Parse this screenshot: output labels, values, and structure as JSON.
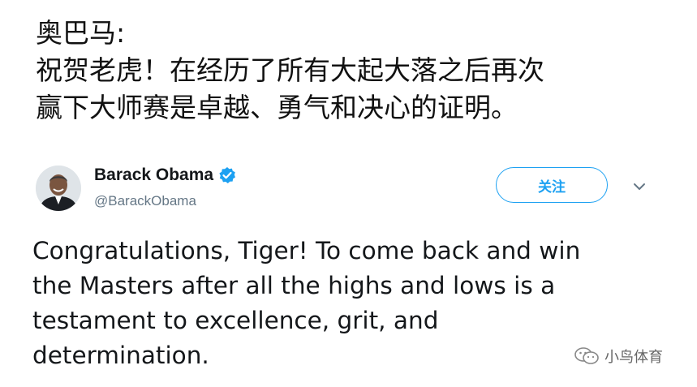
{
  "headline": {
    "line1": "奥巴马:",
    "line2": "祝贺老虎！在经历了所有大起大落之后再次",
    "line3": "赢下大师赛是卓越、勇气和决心的证明。"
  },
  "tweet": {
    "display_name": "Barack Obama",
    "handle": "@BarackObama",
    "verified_icon": "verified-badge-icon",
    "follow_label": "关注",
    "menu_icon": "chevron-down-icon",
    "body_lines": [
      "Congratulations, Tiger! To come back and win",
      "the Masters after all the highs and lows is a",
      "testament to excellence, grit, and",
      "determination."
    ]
  },
  "watermark": {
    "icon": "wechat-icon",
    "text": "小鸟体育"
  },
  "colors": {
    "accent": "#1da1f2",
    "text": "#14171a",
    "muted": "#657786"
  }
}
